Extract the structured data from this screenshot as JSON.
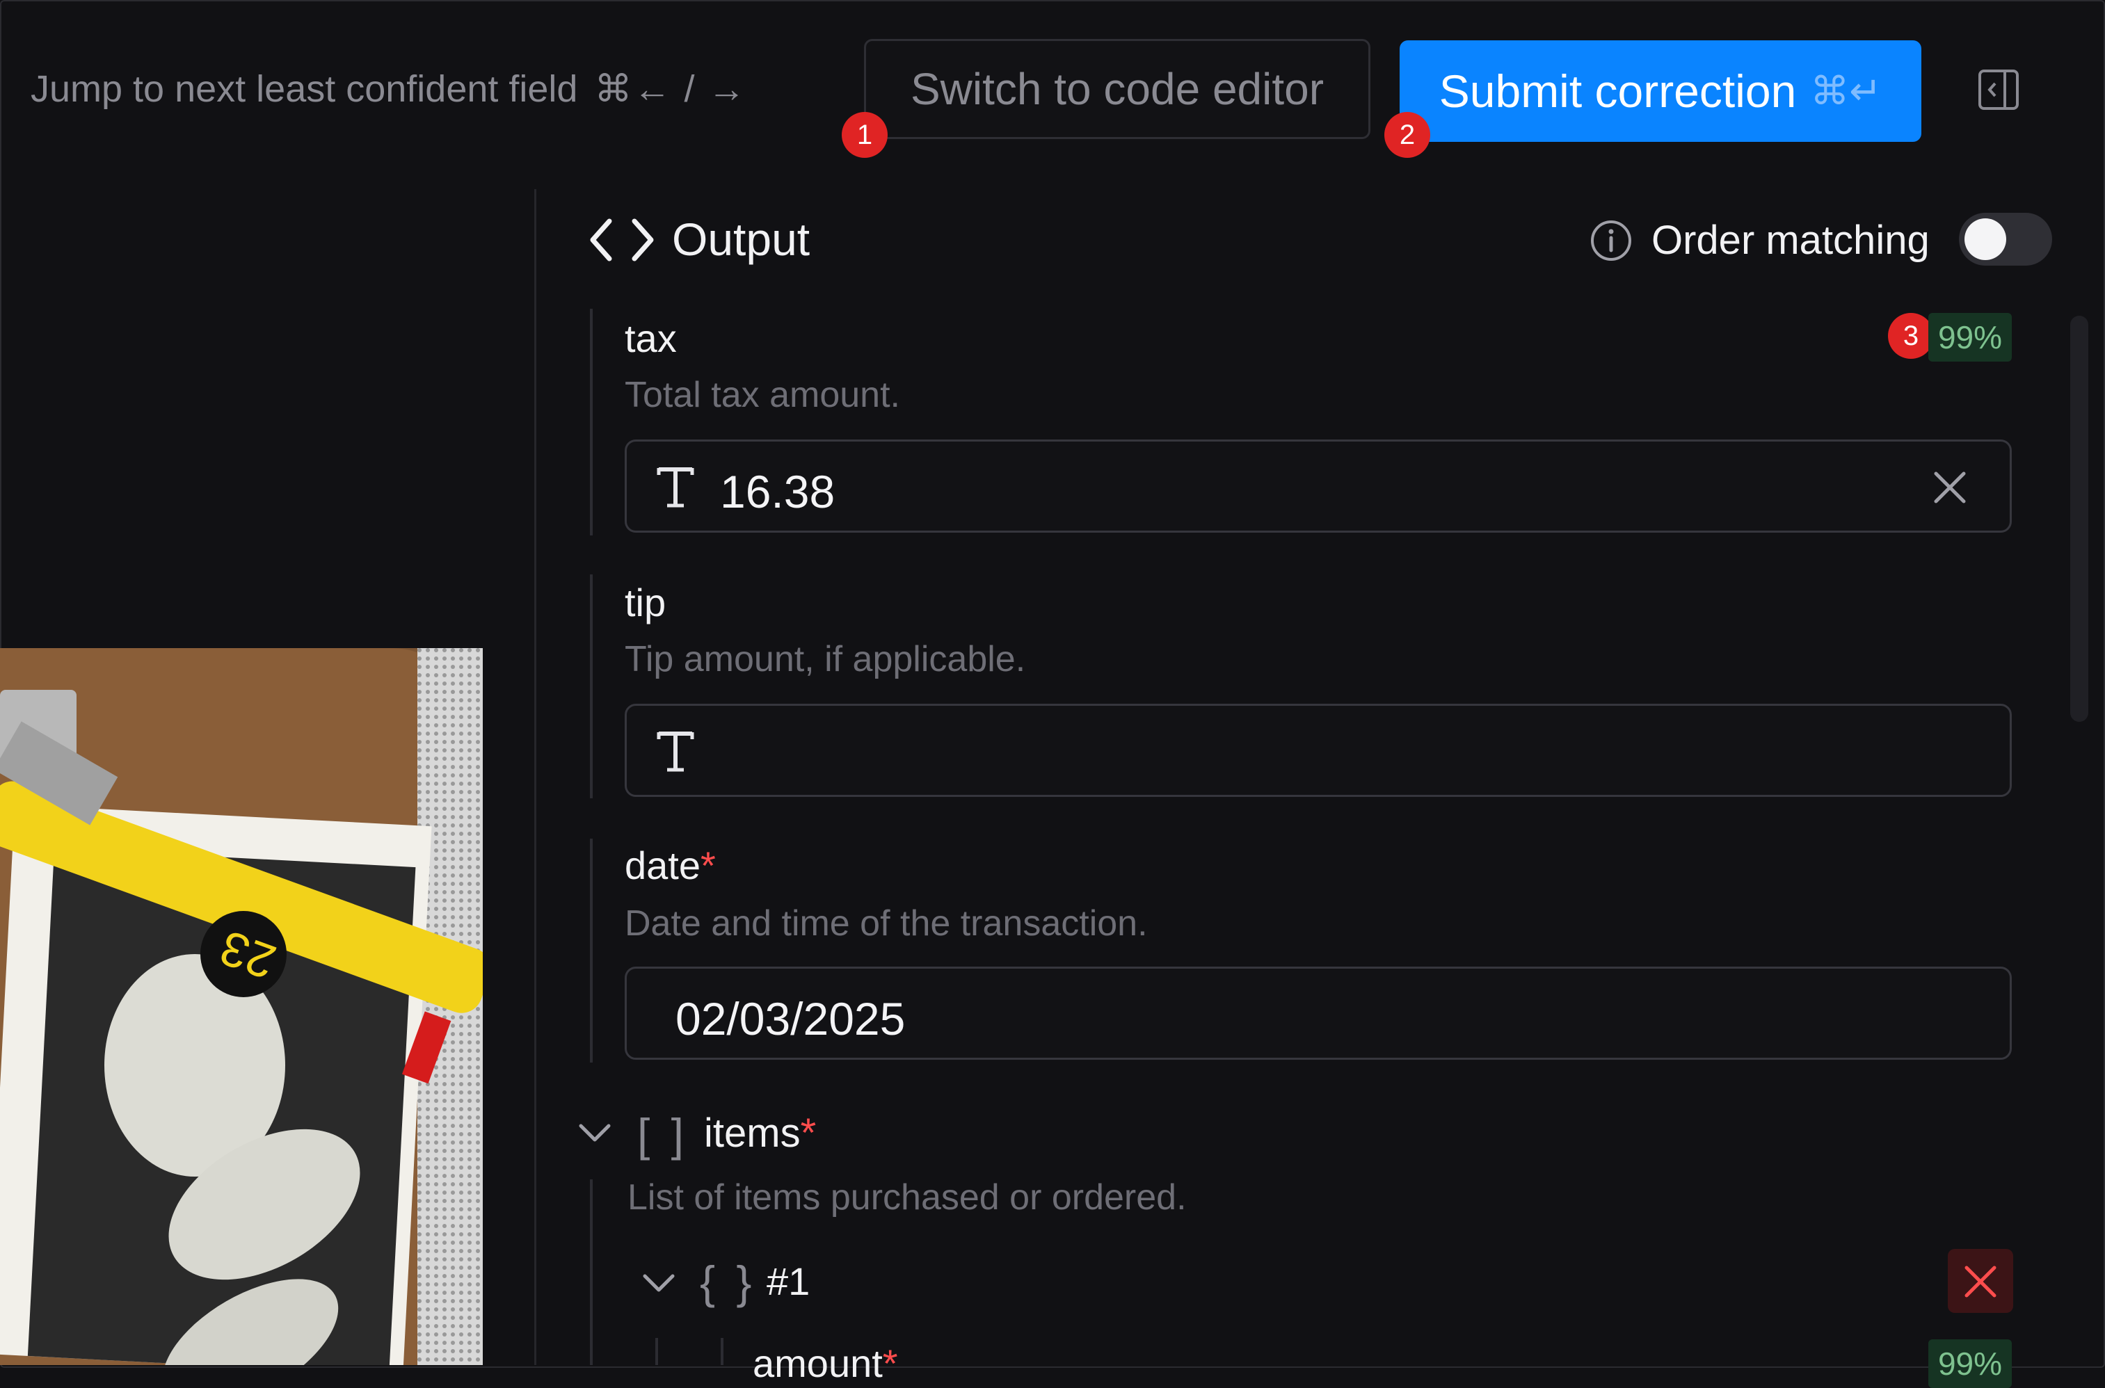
{
  "toolbar": {
    "jump_label": "Jump to next least confident field",
    "jump_keys": "⌘← / →",
    "code_editor_label": "Switch to code editor",
    "submit_label": "Submit correction",
    "submit_keys": "⌘↵",
    "markers": [
      "1",
      "2"
    ]
  },
  "output": {
    "title": "Output",
    "order_matching_label": "Order matching",
    "order_matching_on": false
  },
  "fields": {
    "tax": {
      "label": "tax",
      "description": "Total tax amount.",
      "value": "16.38",
      "confidence": "99%",
      "marker": "3"
    },
    "tip": {
      "label": "tip",
      "description": "Tip amount, if applicable.",
      "value": ""
    },
    "date": {
      "label": "date",
      "required_mark": "*",
      "description": "Date and time of the transaction.",
      "value": "02/03/2025"
    },
    "items": {
      "label": "items",
      "required_mark": "*",
      "bracket": "[ ]",
      "description": "List of items purchased or ordered.",
      "entries": [
        {
          "label": "#1",
          "bracket": "{ }",
          "first_field": "amount",
          "first_field_required": "*",
          "confidence": "99%"
        }
      ]
    }
  },
  "colors": {
    "background": "#111114",
    "accent": "#0a84ff",
    "marker": "#e02424",
    "confidence_bg": "#163423",
    "confidence_fg": "#7ec28f",
    "required": "#ff4d4d"
  }
}
